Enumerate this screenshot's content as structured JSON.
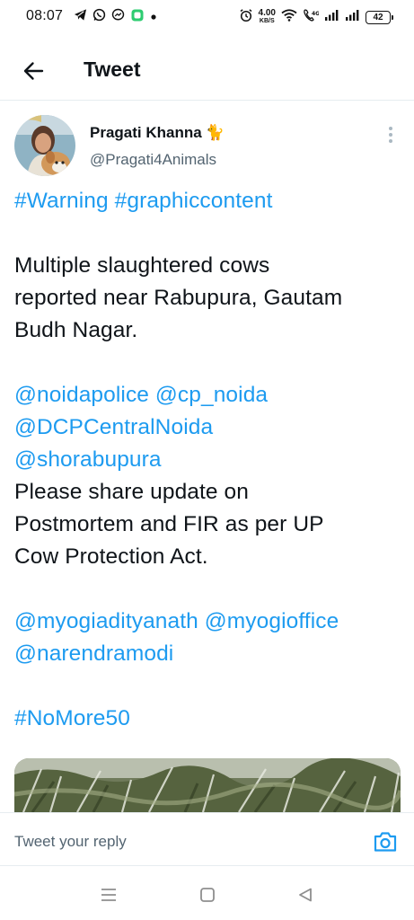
{
  "status_bar": {
    "time": "08:07",
    "net_speed_value": "4.00",
    "net_speed_unit": "KB/S",
    "battery": "42",
    "notification_icons": [
      "telegram-icon",
      "whatsapp-icon",
      "messenger-icon",
      "app-icon",
      "dot-icon"
    ],
    "system_icons": [
      "alarm-icon",
      "wifi-icon",
      "volte-icon",
      "signal-icon",
      "signal-icon",
      "battery-icon"
    ]
  },
  "header": {
    "title": "Tweet"
  },
  "tweet": {
    "author_name": "Pragati Khanna",
    "author_emoji": "🐈",
    "author_handle": "@Pragati4Animals",
    "lines": [
      [
        {
          "text": "#Warning #graphiccontent",
          "link": true
        }
      ],
      [],
      [
        {
          "text": "Multiple slaughtered cows",
          "link": false
        }
      ],
      [
        {
          "text": "reported near Rabupura, Gautam",
          "link": false
        }
      ],
      [
        {
          "text": "Budh Nagar.",
          "link": false
        }
      ],
      [],
      [
        {
          "text": "@noidapolice @cp_noida",
          "link": true
        }
      ],
      [
        {
          "text": "@DCPCentralNoida",
          "link": true
        }
      ],
      [
        {
          "text": "@shorabupura",
          "link": true
        }
      ],
      [
        {
          "text": "Please share update on",
          "link": false
        }
      ],
      [
        {
          "text": "Postmortem and FIR as per UP",
          "link": false
        }
      ],
      [
        {
          "text": "Cow Protection Act.",
          "link": false
        }
      ],
      [],
      [
        {
          "text": "@myogiadityanath @myogioffice",
          "link": true
        }
      ],
      [
        {
          "text": "@narendramodi",
          "link": true
        }
      ],
      [],
      [
        {
          "text": "#NoMore50",
          "link": true
        }
      ]
    ]
  },
  "reply": {
    "placeholder": "Tweet your reply"
  },
  "colors": {
    "link": "#1d9bf0",
    "text": "#0f1419",
    "muted": "#536471",
    "divider": "#e6ecf0"
  }
}
